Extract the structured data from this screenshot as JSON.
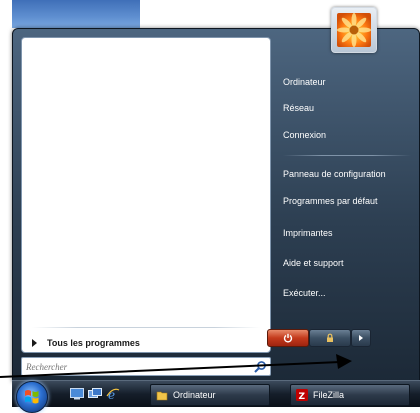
{
  "start_menu": {
    "all_programs": "Tous les programmes",
    "right_items": [
      {
        "label": "Ordinateur"
      },
      {
        "label": "Réseau"
      },
      {
        "label": "Connexion"
      },
      {
        "label": "Panneau de configuration"
      },
      {
        "label": "Programmes par défaut"
      },
      {
        "label": "Imprimantes"
      },
      {
        "label": "Aide et support"
      },
      {
        "label": "Exécuter..."
      }
    ],
    "search": {
      "placeholder": "Rechercher"
    }
  },
  "taskbar": {
    "buttons": [
      {
        "label": "Ordinateur",
        "icon": "folder-icon"
      },
      {
        "label": "FileZilla",
        "icon": "filezilla-icon"
      }
    ]
  },
  "colors": {
    "menu_bg": "#2d3f52",
    "power_red": "#c43a1c",
    "taskbar": "#151e2a"
  }
}
